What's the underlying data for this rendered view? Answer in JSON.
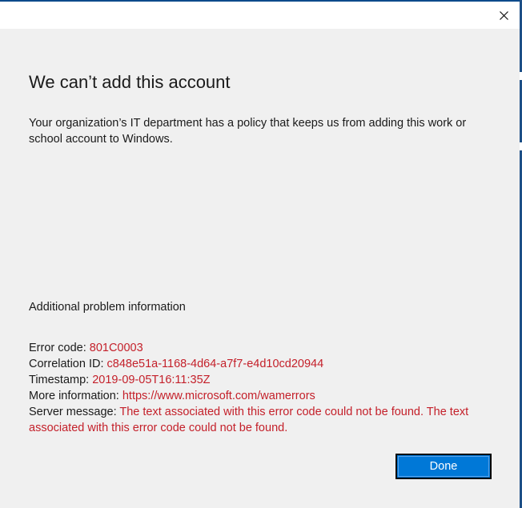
{
  "dialog": {
    "heading": "We can’t add this account",
    "description": "Your organization’s IT department has a policy that keeps us from adding this work or school account to Windows.",
    "additional_heading": "Additional problem information",
    "details": [
      {
        "label": "Error code: ",
        "value": "801C0003"
      },
      {
        "label": "Correlation ID: ",
        "value": "c848e51a-1168-4d64-a7f7-e4d10cd20944"
      },
      {
        "label": "Timestamp: ",
        "value": "2019-09-05T16:11:35Z"
      },
      {
        "label": "More information: ",
        "value": "https://www.microsoft.com/wamerrors"
      },
      {
        "label": "Server message: ",
        "value": "The text associated with this error code could not be found. The text associated with this error code could not be found."
      }
    ],
    "done_label": "Done"
  },
  "titlebar": {
    "close_icon": "close-icon"
  },
  "colors": {
    "accent": "#0078d7",
    "error_text": "#c4202a",
    "background": "#f0f0f0"
  }
}
